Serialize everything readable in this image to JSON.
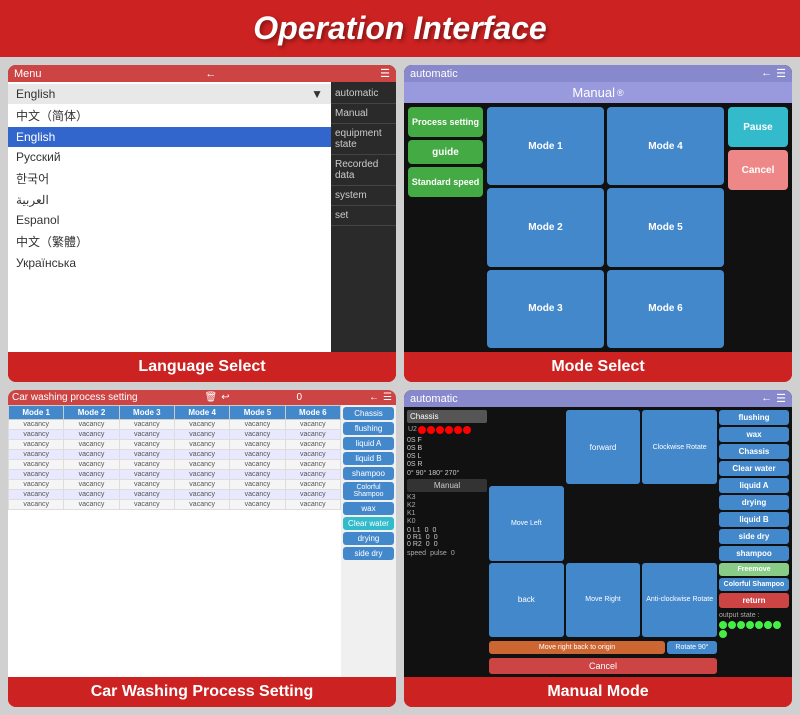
{
  "header": {
    "title": "Operation Interface"
  },
  "cards": [
    {
      "id": "language-select",
      "label": "Language Select",
      "screen_title": "Menu"
    },
    {
      "id": "mode-select",
      "label": "Mode Select",
      "screen_title": "Manual"
    },
    {
      "id": "car-washing",
      "label": "Car Washing Process Setting",
      "screen_title": "Car washing process setting"
    },
    {
      "id": "manual-mode",
      "label": "Manual Mode",
      "screen_title": "Manual"
    }
  ],
  "language_screen": {
    "menu_label": "Menu",
    "languages": [
      {
        "name": "English",
        "selected": false,
        "dropdown": true
      },
      {
        "name": "中文（简体）",
        "selected": false
      },
      {
        "name": "English",
        "selected": true
      },
      {
        "name": "Русский",
        "selected": false
      },
      {
        "name": "한국어",
        "selected": false
      },
      {
        "name": "العربية",
        "selected": false
      },
      {
        "name": "Espanol",
        "selected": false
      },
      {
        "name": "中文（繁體）",
        "selected": false
      },
      {
        "name": "Українська",
        "selected": false
      }
    ],
    "sidebar_items": [
      "automatic",
      "Manual",
      "equipment state",
      "Recorded data",
      "system",
      "set"
    ]
  },
  "mode_screen": {
    "title": "Manual",
    "left_buttons": [
      "Process setting",
      "guide",
      "Standard speed"
    ],
    "center_buttons": [
      "Mode 1",
      "Mode 4",
      "Mode 2",
      "Mode 5",
      "Mode 3",
      "Mode 6"
    ],
    "right_buttons": [
      "Pause",
      "Cancel"
    ]
  },
  "wash_screen": {
    "title": "Car washing process setting",
    "columns": [
      "Mode 1",
      "Mode 2",
      "Mode 3",
      "Mode 4",
      "Mode 5",
      "Mode 6"
    ],
    "right_buttons": [
      "Chassis",
      "flushing",
      "liquid A",
      "liquid B",
      "shampoo",
      "Colorful Shampoo",
      "wax",
      "Clear water",
      "drying",
      "side dry"
    ],
    "rows": 9
  },
  "manual_screen": {
    "title": "Manual",
    "chassis_label": "Chassis",
    "angles": [
      "0S F",
      "0S B",
      "0S L",
      "0S R",
      "0°",
      "90°",
      "180°",
      "270°"
    ],
    "k_labels": [
      "K3",
      "K2",
      "K1",
      "K0"
    ],
    "nav_buttons": [
      "forward",
      "Move Left",
      "Clockwise Rotate",
      "back",
      "Move Right",
      "Anti-clockwise Rotate",
      "Move right back to origin",
      "Rotate 90°"
    ],
    "speed_labels": [
      "L1",
      "R1",
      "R2"
    ],
    "right_buttons": [
      "flushing",
      "wax",
      "Chassis",
      "Clear water",
      "liquid A",
      "drying",
      "liquid B",
      "side dry",
      "shampoo",
      "Freemove",
      "Colorful Shampoo",
      "return"
    ],
    "output_label": "output state :",
    "cancel_label": "Cancel"
  }
}
